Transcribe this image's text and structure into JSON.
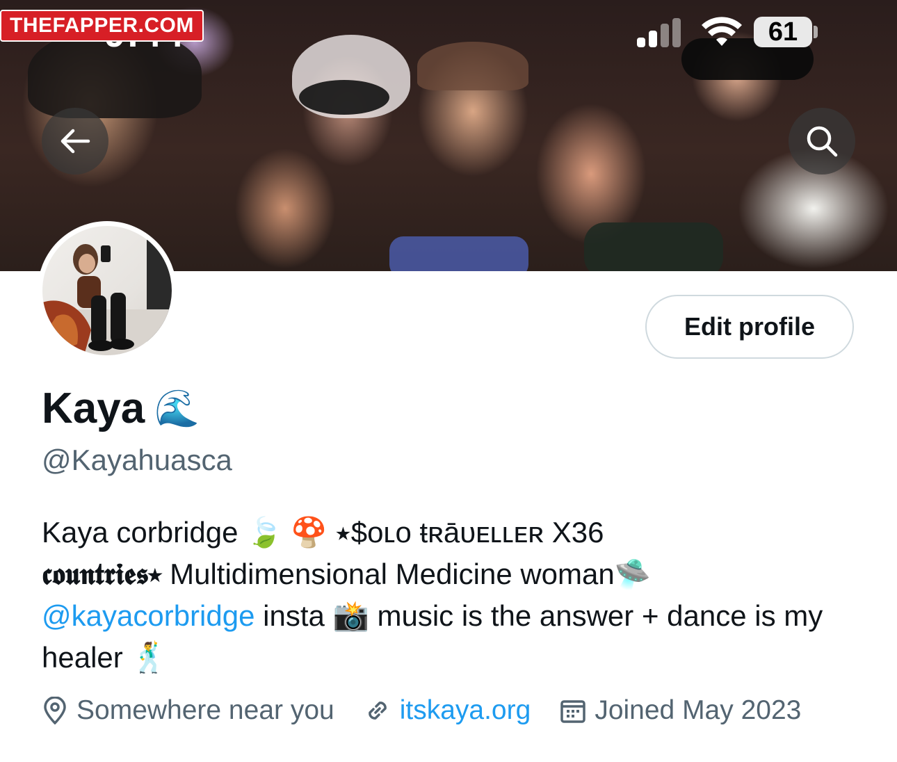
{
  "status_bar": {
    "time": "9:44",
    "battery": "61"
  },
  "watermark": "THEFAPPER.COM",
  "header": {
    "back_icon": "arrow-left-icon",
    "search_icon": "search-icon"
  },
  "profile": {
    "edit_label": "Edit profile",
    "display_name": "Kaya",
    "name_emoji": "🌊",
    "handle": "@Kayahuasca",
    "bio": {
      "part1": "Kaya corbridge",
      "emoji_leaf": "🍃",
      "emoji_mushroom": "🍄",
      "styled_travel": "⭑$ᴏʟᴏ ŧʀāᴜᴇʟʟᴇʀ",
      "part2": "X36",
      "styled_countries": "𝖈𝖔𝖚𝖓𝖙𝖗𝖎𝖊𝖘⭑",
      "part3": "Multidimensional Medicine woman",
      "emoji_ufo": "🛸",
      "mention": "@kayacorbridge",
      "part4": "insta",
      "emoji_camera": "📸",
      "part5": "music is the answer + dance is my healer",
      "emoji_dancer": "🕺"
    },
    "location": "Somewhere near you",
    "website": "itskaya.org",
    "joined": "Joined May 2023"
  },
  "colors": {
    "accent": "#1d9bf0",
    "secondary_text": "#536471",
    "primary_text": "#0f1419",
    "border": "#cfd9de"
  }
}
